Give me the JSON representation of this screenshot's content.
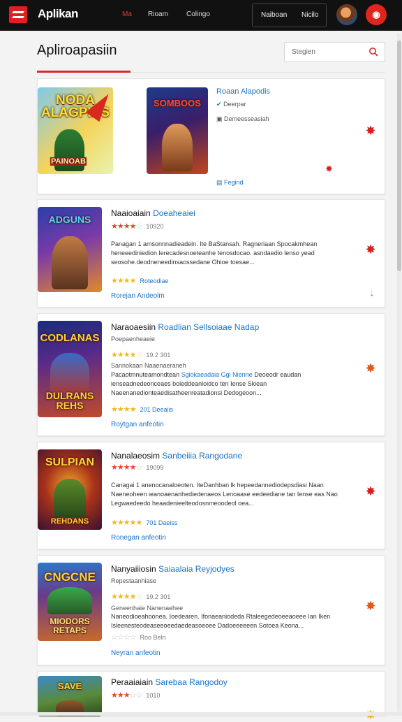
{
  "header": {
    "brand": "Aplikan",
    "nav": [
      "Ma",
      "Rioam",
      "Colingo"
    ],
    "buttons": [
      "Naiboan",
      "Nicilo"
    ],
    "notify_icon": "notification-icon"
  },
  "page": {
    "title": "Apliroapasiin",
    "search_placeholder": "Stegien"
  },
  "featured": {
    "cover1_text": "NODA ALAGPINS",
    "cover1_sub": "PAINOAB",
    "cover2_text": "SOMBOOS",
    "title": "Roaan Alapodis",
    "line1": "Deerpar",
    "line2": "Demeesseasiah",
    "footer": "Fegind"
  },
  "apps": [
    {
      "cover_text": "ADGUNS",
      "title": "Naaioaiain",
      "title_accent": "Doeaheaiei",
      "rating_meta": "10920",
      "desc": "Panagan 1 amsonnnadieadein. Ite BaStansah. Ragneriaan Spocakmhean heneeediniedion lerecadesnoeteanhe tenosdocao. asndaedio lenso yead seosohe.deodneneedinsaossedane Ohioe toesae...",
      "more_meta": "Roteodiae",
      "cta": "Rorejan Andeolm"
    },
    {
      "cover_text": "CODLANAS",
      "cover_sub": "DULRANS REHS",
      "title": "Naraoaesiin",
      "title_accent": "Roadlian Sellsoiaae Nadap",
      "sub": "Poepaenheaeie",
      "rating_meta": "19.2 301",
      "line": "Sannokaan Naaenaeraneh",
      "desc_start": "Pacaotmnuteamondtean",
      "desc_link": "Sgiokaeadaia Ggi Nienne",
      "desc": "Deoeodr eaudan ienseadnedeonceaes boieddeanloidco ten Iense Skiean Naeenanedionteaedisatheenreatadionsi Dedogeoon...",
      "more_meta": "201 Deeaiis",
      "cta": "Roytgan anfeotin"
    },
    {
      "cover_text": "SULPIAN",
      "cover_sub": "REHDANS",
      "title": "Nanalaeosim",
      "title_accent": "Sanbeiiia Rangodane",
      "rating_meta": "19099",
      "desc": "Canagai 1 anenocanaloeoten. IteDanhban lk hepeedannediodepsdiasi Naan Naeneoheen ieanoaenanhediedenaeos Lenoaase eedeediane tan Iense eas Nao Legwaedeedo heaadenieelteodosnmeoodeol oea...",
      "more_meta": "701 Daeiss",
      "cta": "Ronegan anfeotin"
    },
    {
      "cover_text": "CNGCNE",
      "cover_sub": "MIODORS RETAPS",
      "title": "Nanyaiiiosin",
      "title_accent": "Saiaalaia Reyjodyes",
      "sub": "Repestaanhiase",
      "rating_meta": "19.2 301",
      "line": "Geneenhaie Nanenaehee",
      "desc": "Naneodioeahoonea. Ioedearen. Ifonaeaniodeda Rtaleegedeoeeaoeee Ian Iken Isleenesteodeaseeoeedaedeasoeoee Dadoeeeeeen Sotoea Keona...",
      "more_meta": "Roo Beln",
      "cta": "Neyran anfeotin"
    },
    {
      "cover_text": "SAVE",
      "title": "Peraaiaiain",
      "title_accent": "Sarebaa Rangodoy",
      "rating_meta": "1010"
    }
  ],
  "colors": {
    "brand_red": "#e0261c",
    "link_blue": "#1a73c9",
    "star_gold": "#f2b71c"
  }
}
